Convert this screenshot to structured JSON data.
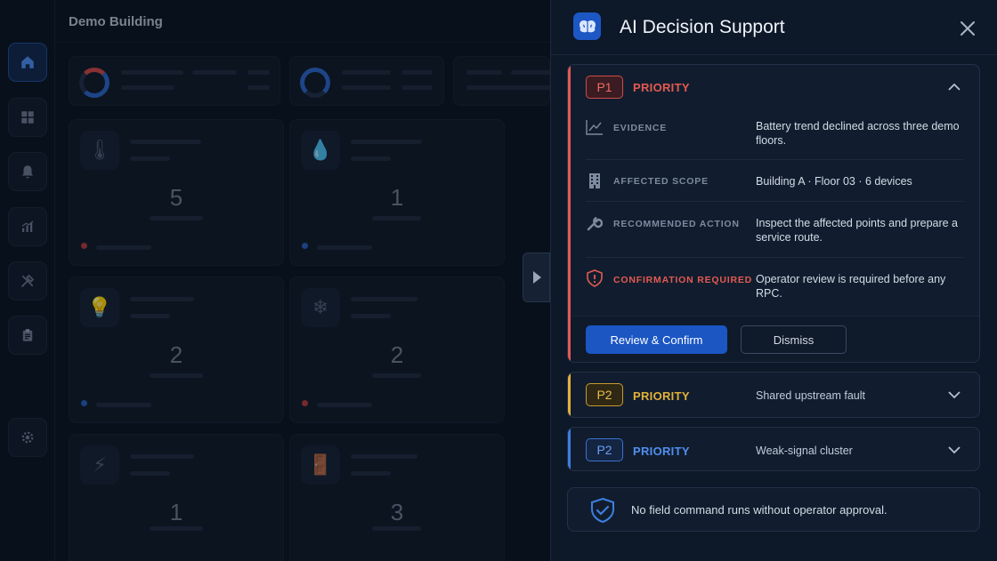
{
  "dashboard": {
    "title": "Demo Building",
    "tiles": [
      {
        "icon": "thermometer-icon",
        "glyph": "🌡",
        "value": "5",
        "status": "red"
      },
      {
        "icon": "water-drop-icon",
        "glyph": "💧",
        "value": "1",
        "status": "blue"
      },
      {
        "icon": "light-bulb-icon",
        "glyph": "💡",
        "value": "2",
        "status": "blue"
      },
      {
        "icon": "snowflake-icon",
        "glyph": "❄",
        "value": "2",
        "status": "red"
      },
      {
        "icon": "lightning-icon",
        "glyph": "⚡",
        "value": "1",
        "status": "blue"
      },
      {
        "icon": "door-icon",
        "glyph": "🚪",
        "value": "3",
        "status": "blue"
      }
    ]
  },
  "sidebar": {
    "items": [
      {
        "name": "home",
        "icon": "home-icon"
      },
      {
        "name": "dashboard",
        "icon": "grid-icon"
      },
      {
        "name": "alerts",
        "icon": "bell-icon"
      },
      {
        "name": "analytics",
        "icon": "chart-icon"
      },
      {
        "name": "maintenance",
        "icon": "tools-icon"
      },
      {
        "name": "reports",
        "icon": "clipboard-icon"
      },
      {
        "name": "settings",
        "icon": "gear-icon"
      }
    ]
  },
  "panel": {
    "title": "AI Decision Support",
    "p1": {
      "badge": "P1",
      "label": "PRIORITY",
      "color": "#e35a52",
      "rows": [
        {
          "label": "EVIDENCE",
          "value": "Battery trend declined across three demo floors.",
          "icon": "trend-chart-icon"
        },
        {
          "label": "AFFECTED SCOPE",
          "value": "Building A · Floor 03 · 6 devices",
          "icon": "building-icon"
        },
        {
          "label": "RECOMMENDED ACTION",
          "value": "Inspect the affected points and prepare a service route.",
          "icon": "wrench-icon"
        },
        {
          "label": "CONFIRMATION REQUIRED",
          "value": "Operator review is required before any RPC.",
          "icon": "shield-alert-icon"
        }
      ],
      "primary_action": "Review & Confirm",
      "secondary_action": "Dismiss"
    },
    "p2a": {
      "badge": "P2",
      "label": "PRIORITY",
      "summary": "Shared upstream fault",
      "color": "#e3b13a"
    },
    "p2b": {
      "badge": "P2",
      "label": "PRIORITY",
      "summary": "Weak-signal cluster",
      "color": "#3d7fe0"
    },
    "notice": "No field command runs without operator approval."
  }
}
